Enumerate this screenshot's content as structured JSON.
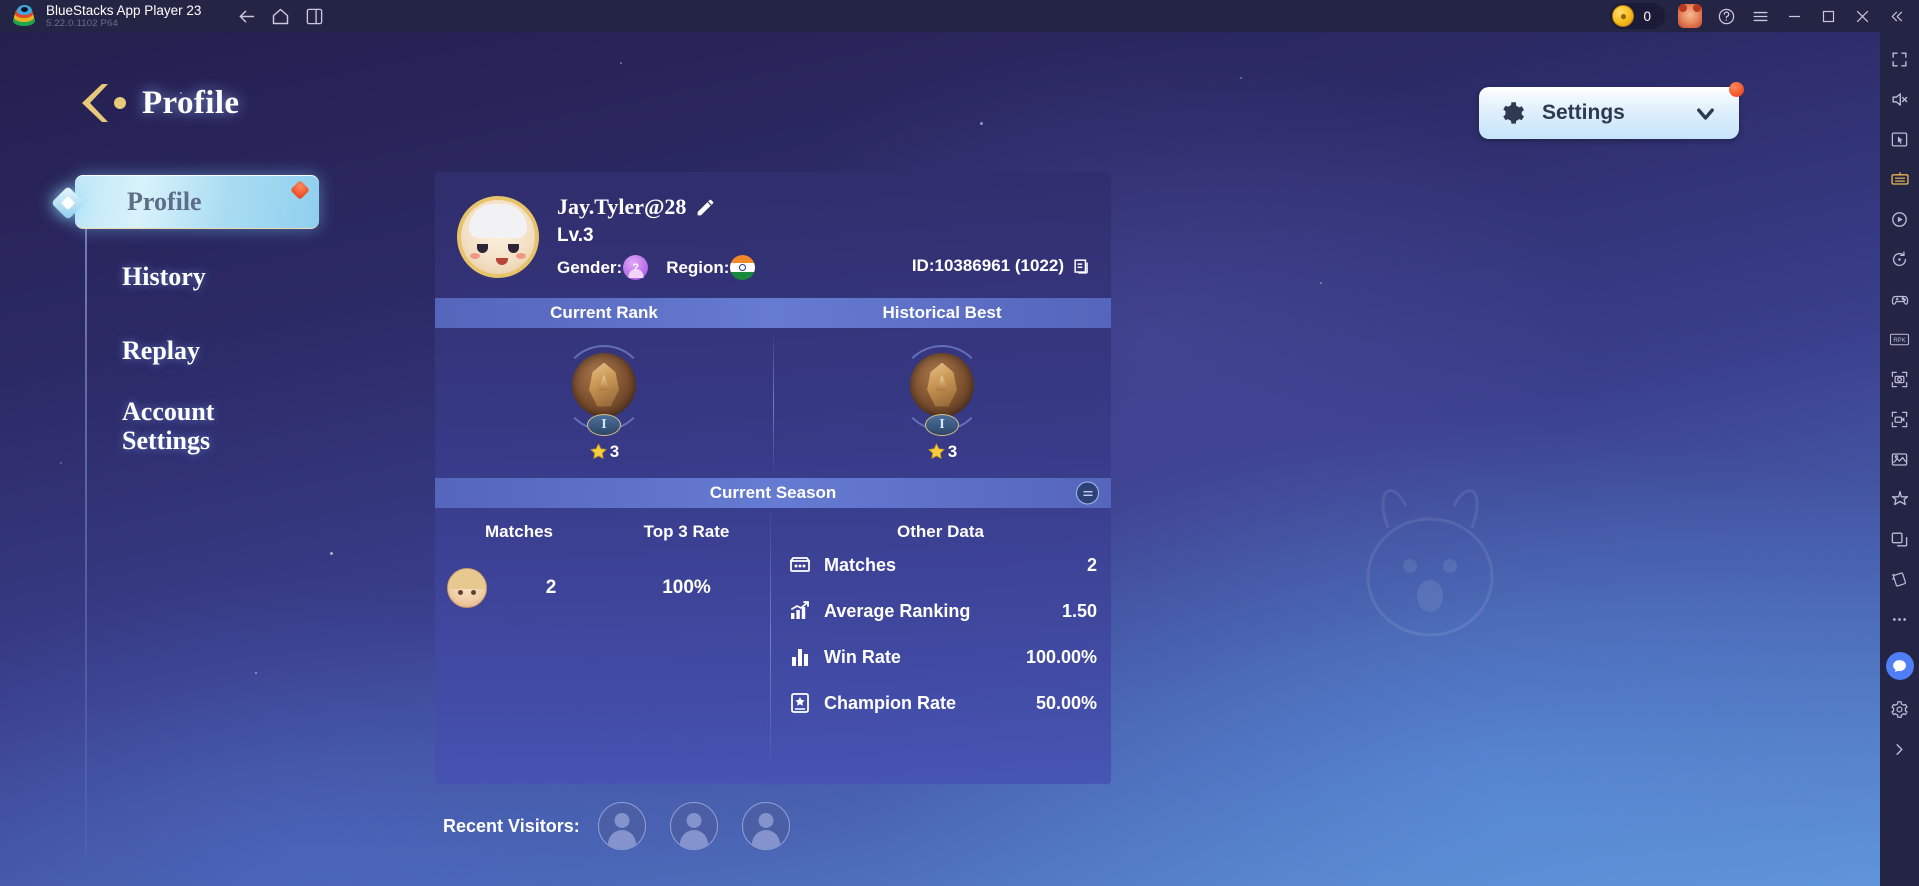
{
  "titlebar": {
    "app_name": "BlueStacks App Player 23",
    "version": "5.22.0.1102  P64",
    "logo_icon": "bluestacks-logo",
    "nav": [
      {
        "name": "back-button",
        "icon": "arrow-left-icon"
      },
      {
        "name": "home-button",
        "icon": "home-icon"
      },
      {
        "name": "multi-instance-button",
        "icon": "windows-icon"
      }
    ],
    "coin_value": "0",
    "coin_icon": "coin-icon",
    "account_icon": "bear-avatar-icon",
    "help_icon": "question-circle-icon",
    "menu_icon": "hamburger-menu-icon",
    "minimize_icon": "minimize-icon",
    "maximize_icon": "maximize-icon",
    "close_icon": "close-icon",
    "collapse_icon": "double-chevron-left-icon"
  },
  "header": {
    "title": "Profile",
    "back_icon": "gold-chevron-back-icon"
  },
  "settings": {
    "label": "Settings",
    "gear_icon": "gear-icon",
    "chevron_icon": "chevron-down-icon",
    "has_notification": true,
    "notification_color": "#e8380d"
  },
  "sidebar": {
    "items": [
      {
        "label": "Profile",
        "active": true,
        "badge": true
      },
      {
        "label": "History",
        "active": false,
        "badge": false
      },
      {
        "label": "Replay",
        "active": false,
        "badge": false
      },
      {
        "label": "Account Settings",
        "active": false,
        "badge": false
      }
    ]
  },
  "player": {
    "avatar_icon": "player-avatar",
    "username": "Jay.Tyler@28",
    "edit_icon": "edit-pencil-icon",
    "level": "Lv.3",
    "gender_label": "Gender:",
    "gender_icon": "unknown-gender-icon",
    "region_label": "Region:",
    "region_icon": "india-flag-icon",
    "id_text": "ID:10386961 (1022)",
    "copy_icon": "copy-icon"
  },
  "rank": {
    "current_label": "Current Rank",
    "historical_label": "Historical Best",
    "current": {
      "tier": "I",
      "stars": "3",
      "badge_icon": "bronze-eagle-badge"
    },
    "historical": {
      "tier": "I",
      "stars": "3",
      "badge_icon": "bronze-eagle-badge"
    },
    "star_icon": "star-icon"
  },
  "season": {
    "title": "Current Season",
    "switch_icon": "season-switch-icon",
    "columns": {
      "matches": "Matches",
      "top3": "Top 3 Rate"
    },
    "hero_row": {
      "hero_icon": "hero-portrait",
      "matches": "2",
      "top3_rate": "100%"
    },
    "other_data_title": "Other Data",
    "stats": [
      {
        "icon": "matches-board-icon",
        "label": "Matches",
        "value": "2"
      },
      {
        "icon": "trending-chart-icon",
        "label": "Average Ranking",
        "value": "1.50"
      },
      {
        "icon": "bar-chart-icon",
        "label": "Win Rate",
        "value": "100.00%"
      },
      {
        "icon": "champion-card-icon",
        "label": "Champion Rate",
        "value": "50.00%"
      }
    ]
  },
  "visitors": {
    "label": "Recent Visitors:",
    "slots": [
      {
        "icon": "empty-visitor-avatar"
      },
      {
        "icon": "empty-visitor-avatar"
      },
      {
        "icon": "empty-visitor-avatar"
      }
    ]
  },
  "rail": {
    "buttons": [
      {
        "name": "fullscreen-icon"
      },
      {
        "name": "mute-icon"
      },
      {
        "name": "cursor-icon"
      },
      {
        "name": "keymapping-icon"
      },
      {
        "name": "macro-play-icon"
      },
      {
        "name": "rotate-icon"
      },
      {
        "name": "gamepad-icon"
      },
      {
        "name": "rpk-icon"
      },
      {
        "name": "screenshot-icon"
      },
      {
        "name": "record-icon"
      },
      {
        "name": "media-manager-icon"
      },
      {
        "name": "eco-mode-icon"
      },
      {
        "name": "multi-window-icon"
      },
      {
        "name": "shake-icon"
      },
      {
        "name": "more-icon"
      },
      {
        "name": "chat-icon"
      },
      {
        "name": "settings-gear-icon"
      },
      {
        "name": "expand-icon"
      }
    ]
  },
  "theme": {
    "accent": "#5f93d6",
    "card_bg": "#3a3f8c",
    "gold": "#e7c36a",
    "notification_red": "#e8380d"
  }
}
